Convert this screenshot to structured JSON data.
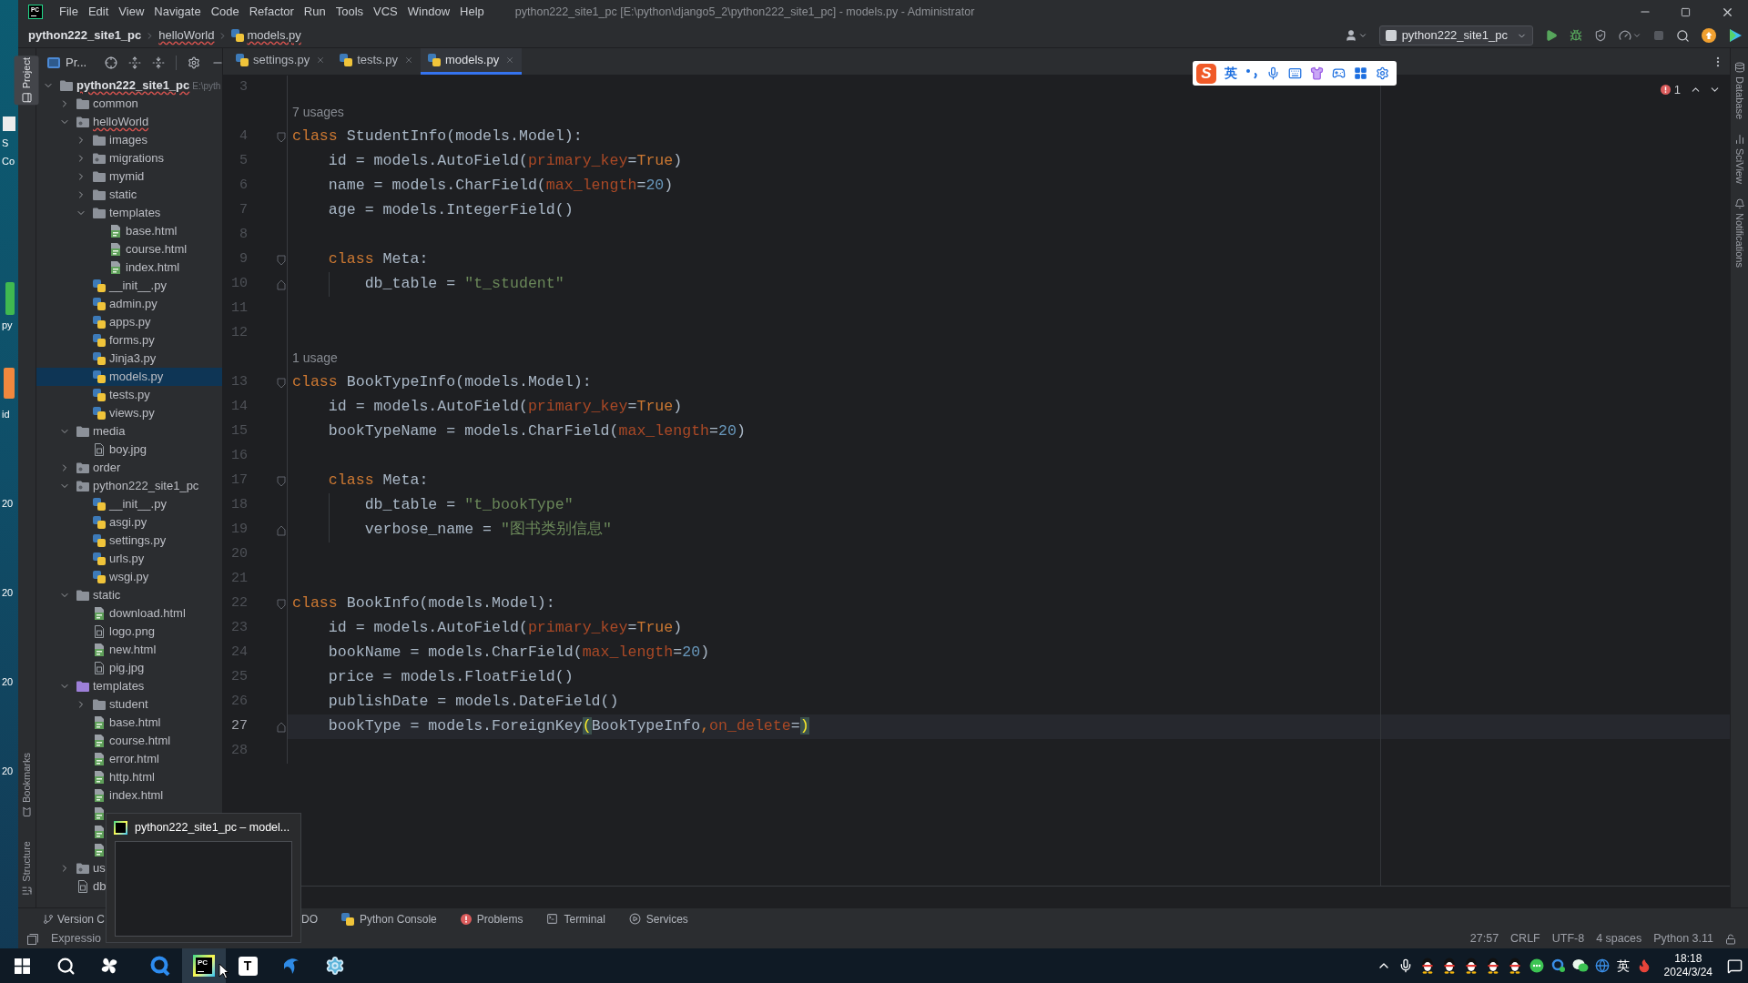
{
  "desktop": {
    "labels": [
      "S",
      "Co",
      "py",
      "id",
      "20",
      "20",
      "20",
      "20"
    ]
  },
  "window": {
    "logo": "PC",
    "menu": [
      "File",
      "Edit",
      "View",
      "Navigate",
      "Code",
      "Refactor",
      "Run",
      "Tools",
      "VCS",
      "Window",
      "Help"
    ],
    "title": "python222_site1_pc [E:\\python\\django5_2\\python222_site1_pc] - models.py - Administrator"
  },
  "breadcrumb": [
    {
      "label": "python222_site1_pc",
      "kind": "project",
      "error": false
    },
    {
      "label": "helloWorld",
      "kind": "folder",
      "error": true
    },
    {
      "label": "models.py",
      "kind": "file",
      "error": true
    }
  ],
  "run_config": {
    "label": "python222_site1_pc"
  },
  "left_tool_strip": {
    "top": [
      {
        "label": "Project",
        "selected": true
      }
    ],
    "bottom": [
      {
        "label": "Bookmarks",
        "selected": false
      },
      {
        "label": "Structure",
        "selected": false
      }
    ]
  },
  "right_tool_strip": [
    {
      "label": "Database",
      "selected": false
    },
    {
      "label": "SciView",
      "selected": false
    },
    {
      "label": "Notifications",
      "selected": false
    }
  ],
  "project_panel": {
    "title": "Pr...",
    "tree": [
      {
        "name": "python222_site1_pc",
        "path": "E:\\pyth",
        "kind": "folder",
        "selected": false,
        "error": true,
        "expanded": true,
        "children": [
          {
            "name": "common",
            "kind": "folder",
            "selected": false,
            "error": false,
            "expanded": false
          },
          {
            "name": "helloWorld",
            "kind": "package",
            "selected": false,
            "error": true,
            "expanded": true,
            "children": [
              {
                "name": "images",
                "kind": "folder",
                "selected": false,
                "error": false,
                "expanded": false
              },
              {
                "name": "migrations",
                "kind": "package",
                "selected": false,
                "error": false,
                "expanded": false
              },
              {
                "name": "mymid",
                "kind": "folder",
                "selected": false,
                "error": false,
                "expanded": false
              },
              {
                "name": "static",
                "kind": "folder",
                "selected": false,
                "error": false,
                "expanded": false
              },
              {
                "name": "templates",
                "kind": "folder",
                "selected": false,
                "error": false,
                "expanded": true,
                "children": [
                  {
                    "name": "base.html",
                    "kind": "html",
                    "selected": false,
                    "error": false
                  },
                  {
                    "name": "course.html",
                    "kind": "html",
                    "selected": false,
                    "error": false
                  },
                  {
                    "name": "index.html",
                    "kind": "html",
                    "selected": false,
                    "error": false
                  }
                ]
              },
              {
                "name": "__init__.py",
                "kind": "python",
                "selected": false,
                "error": false
              },
              {
                "name": "admin.py",
                "kind": "python",
                "selected": false,
                "error": false
              },
              {
                "name": "apps.py",
                "kind": "python",
                "selected": false,
                "error": false
              },
              {
                "name": "forms.py",
                "kind": "python",
                "selected": false,
                "error": false
              },
              {
                "name": "Jinja3.py",
                "kind": "python",
                "selected": false,
                "error": false
              },
              {
                "name": "models.py",
                "kind": "python",
                "selected": true,
                "error": false
              },
              {
                "name": "tests.py",
                "kind": "python",
                "selected": false,
                "error": false
              },
              {
                "name": "views.py",
                "kind": "python",
                "selected": false,
                "error": false
              }
            ]
          },
          {
            "name": "media",
            "kind": "folder",
            "selected": false,
            "error": false,
            "expanded": true,
            "children": [
              {
                "name": "boy.jpg",
                "kind": "image",
                "selected": false,
                "error": false
              }
            ]
          },
          {
            "name": "order",
            "kind": "package",
            "selected": false,
            "error": false,
            "expanded": false
          },
          {
            "name": "python222_site1_pc",
            "kind": "package",
            "selected": false,
            "error": false,
            "expanded": true,
            "children": [
              {
                "name": "__init__.py",
                "kind": "python",
                "selected": false,
                "error": false
              },
              {
                "name": "asgi.py",
                "kind": "python",
                "selected": false,
                "error": false
              },
              {
                "name": "settings.py",
                "kind": "python",
                "selected": false,
                "error": false
              },
              {
                "name": "urls.py",
                "kind": "python",
                "selected": false,
                "error": false
              },
              {
                "name": "wsgi.py",
                "kind": "python",
                "selected": false,
                "error": false
              }
            ]
          },
          {
            "name": "static",
            "kind": "folder",
            "selected": false,
            "error": false,
            "expanded": true,
            "children": [
              {
                "name": "download.html",
                "kind": "html",
                "selected": false,
                "error": false
              },
              {
                "name": "logo.png",
                "kind": "image",
                "selected": false,
                "error": false
              },
              {
                "name": "new.html",
                "kind": "html",
                "selected": false,
                "error": false
              },
              {
                "name": "pig.jpg",
                "kind": "image",
                "selected": false,
                "error": false
              }
            ]
          },
          {
            "name": "templates",
            "kind": "resource",
            "selected": false,
            "error": false,
            "expanded": true,
            "children": [
              {
                "name": "student",
                "kind": "folder",
                "selected": false,
                "error": false,
                "expanded": false
              },
              {
                "name": "base.html",
                "kind": "html",
                "selected": false,
                "error": false
              },
              {
                "name": "course.html",
                "kind": "html",
                "selected": false,
                "error": false
              },
              {
                "name": "error.html",
                "kind": "html",
                "selected": false,
                "error": false
              },
              {
                "name": "http.html",
                "kind": "html",
                "selected": false,
                "error": false
              },
              {
                "name": "index.html",
                "kind": "html",
                "selected": false,
                "error": false
              },
              {
                "kind": "html",
                "selected": false
              },
              {
                "kind": "html",
                "selected": false
              },
              {
                "kind": "html",
                "selected": false
              }
            ]
          },
          {
            "name": "us",
            "kind": "package",
            "selected": false,
            "error": false,
            "expanded": false
          },
          {
            "name": "db",
            "kind": "file",
            "selected": false,
            "error": false
          }
        ]
      }
    ]
  },
  "editor_tabs": [
    {
      "label": "settings.py",
      "selected": false
    },
    {
      "label": "tests.py",
      "selected": false
    },
    {
      "label": "models.py",
      "selected": true
    }
  ],
  "ime_toolbar": {
    "logo": "S",
    "language": "英"
  },
  "editor": {
    "problems": "1",
    "lines": [
      {
        "kind": "code",
        "number": "3",
        "current": false
      },
      {
        "kind": "hint",
        "text": "7 usages"
      },
      {
        "kind": "code",
        "number": "4",
        "current": false,
        "fold": {
          "kind": "start"
        },
        "tokens": [
          {
            "kind": "keyword",
            "text": "class"
          },
          {
            "kind": "plain",
            "text": " StudentInfo(models.Model):"
          }
        ]
      },
      {
        "kind": "code",
        "number": "5",
        "current": false,
        "tokens": [
          {
            "kind": "plain",
            "text": "    id = models.AutoField("
          },
          {
            "kind": "param",
            "text": "primary_key"
          },
          {
            "kind": "plain",
            "text": "="
          },
          {
            "kind": "keyword",
            "text": "True"
          },
          {
            "kind": "plain",
            "text": ")"
          }
        ]
      },
      {
        "kind": "code",
        "number": "6",
        "current": false,
        "tokens": [
          {
            "kind": "plain",
            "text": "    name = models.CharField("
          },
          {
            "kind": "param",
            "text": "max_length"
          },
          {
            "kind": "plain",
            "text": "="
          },
          {
            "kind": "number",
            "text": "20"
          },
          {
            "kind": "plain",
            "text": ")"
          }
        ]
      },
      {
        "kind": "code",
        "number": "7",
        "current": false,
        "tokens": [
          {
            "kind": "plain",
            "text": "    age = models.IntegerField()"
          }
        ]
      },
      {
        "kind": "code",
        "number": "8",
        "current": false
      },
      {
        "kind": "code",
        "number": "9",
        "current": false,
        "fold": {
          "kind": "start"
        },
        "tokens": [
          {
            "kind": "keyword",
            "text": "    class"
          },
          {
            "kind": "plain",
            "text": " Meta:"
          }
        ]
      },
      {
        "kind": "code",
        "number": "10",
        "current": false,
        "fold": {
          "kind": "end"
        },
        "tokens": [
          {
            "kind": "plain",
            "text": "        db_table = "
          },
          {
            "kind": "string",
            "text": "\"t_student\""
          }
        ]
      },
      {
        "kind": "code",
        "number": "11",
        "current": false
      },
      {
        "kind": "code",
        "number": "12",
        "current": false
      },
      {
        "kind": "hint",
        "text": "1 usage"
      },
      {
        "kind": "code",
        "number": "13",
        "current": false,
        "fold": {
          "kind": "start"
        },
        "tokens": [
          {
            "kind": "keyword",
            "text": "class"
          },
          {
            "kind": "plain",
            "text": " BookTypeInfo(models.Model):"
          }
        ]
      },
      {
        "kind": "code",
        "number": "14",
        "current": false,
        "tokens": [
          {
            "kind": "plain",
            "text": "    id = models.AutoField("
          },
          {
            "kind": "param",
            "text": "primary_key"
          },
          {
            "kind": "plain",
            "text": "="
          },
          {
            "kind": "keyword",
            "text": "True"
          },
          {
            "kind": "plain",
            "text": ")"
          }
        ]
      },
      {
        "kind": "code",
        "number": "15",
        "current": false,
        "tokens": [
          {
            "kind": "plain",
            "text": "    bookTypeName = models.CharField("
          },
          {
            "kind": "param",
            "text": "max_length"
          },
          {
            "kind": "plain",
            "text": "="
          },
          {
            "kind": "number",
            "text": "20"
          },
          {
            "kind": "plain",
            "text": ")"
          }
        ]
      },
      {
        "kind": "code",
        "number": "16",
        "current": false
      },
      {
        "kind": "code",
        "number": "17",
        "current": false,
        "fold": {
          "kind": "start"
        },
        "tokens": [
          {
            "kind": "keyword",
            "text": "    class"
          },
          {
            "kind": "plain",
            "text": " Meta:"
          }
        ]
      },
      {
        "kind": "code",
        "number": "18",
        "current": false,
        "tokens": [
          {
            "kind": "plain",
            "text": "        db_table = "
          },
          {
            "kind": "string",
            "text": "\"t_bookType\""
          }
        ]
      },
      {
        "kind": "code",
        "number": "19",
        "current": false,
        "fold": {
          "kind": "end"
        },
        "tokens": [
          {
            "kind": "plain",
            "text": "        verbose_name = "
          },
          {
            "kind": "string",
            "text": "\"图书类别信息\""
          }
        ]
      },
      {
        "kind": "code",
        "number": "20",
        "current": false
      },
      {
        "kind": "code",
        "number": "21",
        "current": false
      },
      {
        "kind": "code",
        "number": "22",
        "current": false,
        "fold": {
          "kind": "start"
        },
        "tokens": [
          {
            "kind": "keyword",
            "text": "class"
          },
          {
            "kind": "plain",
            "text": " BookInfo(models.Model):"
          }
        ]
      },
      {
        "kind": "code",
        "number": "23",
        "current": false,
        "tokens": [
          {
            "kind": "plain",
            "text": "    id = models.AutoField("
          },
          {
            "kind": "param",
            "text": "primary_key"
          },
          {
            "kind": "plain",
            "text": "="
          },
          {
            "kind": "keyword",
            "text": "True"
          },
          {
            "kind": "plain",
            "text": ")"
          }
        ]
      },
      {
        "kind": "code",
        "number": "24",
        "current": false,
        "tokens": [
          {
            "kind": "plain",
            "text": "    bookName = models.CharField("
          },
          {
            "kind": "param",
            "text": "max_length"
          },
          {
            "kind": "plain",
            "text": "="
          },
          {
            "kind": "number",
            "text": "20"
          },
          {
            "kind": "plain",
            "text": ")"
          }
        ]
      },
      {
        "kind": "code",
        "number": "25",
        "current": false,
        "tokens": [
          {
            "kind": "plain",
            "text": "    price = models.FloatField()"
          }
        ]
      },
      {
        "kind": "code",
        "number": "26",
        "current": false,
        "tokens": [
          {
            "kind": "plain",
            "text": "    publishDate = models.DateField()"
          }
        ]
      },
      {
        "kind": "code",
        "number": "27",
        "current": true,
        "fold": {
          "kind": "end"
        },
        "tokens": [
          {
            "kind": "plain",
            "text": "    bookType = models.ForeignKey"
          },
          {
            "kind": "brace",
            "text": "("
          },
          {
            "kind": "plain",
            "text": "BookTypeInfo"
          },
          {
            "kind": "keyword",
            "text": ","
          },
          {
            "kind": "param",
            "text": "on_delete"
          },
          {
            "kind": "plain",
            "text": "="
          },
          {
            "kind": "brace",
            "text": ")"
          }
        ]
      },
      {
        "kind": "code",
        "number": "28",
        "current": false
      }
    ]
  },
  "tool_windows": [
    {
      "label": "Version C",
      "kind": "vcs"
    },
    {
      "label": "DO",
      "kind": "partial"
    },
    {
      "label": "Python Console",
      "kind": "console"
    },
    {
      "label": "Problems",
      "kind": "problems"
    },
    {
      "label": "Terminal",
      "kind": "terminal"
    },
    {
      "label": "Services",
      "kind": "services"
    }
  ],
  "status_bar": {
    "left": "Expressio",
    "items": [
      "27:57",
      "CRLF",
      "UTF-8",
      "4 spaces",
      "Python 3.11"
    ]
  },
  "taskbar_preview": {
    "title": "python222_site1_pc – model..."
  },
  "taskbar": {
    "buttons": [
      {
        "selected": false
      },
      {
        "selected": false
      },
      {
        "selected": false
      },
      {
        "selected": false
      },
      {
        "selected": true,
        "logo": "PC"
      },
      {
        "selected": false,
        "logo": "T"
      },
      {
        "selected": false
      },
      {
        "selected": false
      }
    ],
    "input_language": "英",
    "time": "18:18",
    "date": "2024/3/24"
  }
}
